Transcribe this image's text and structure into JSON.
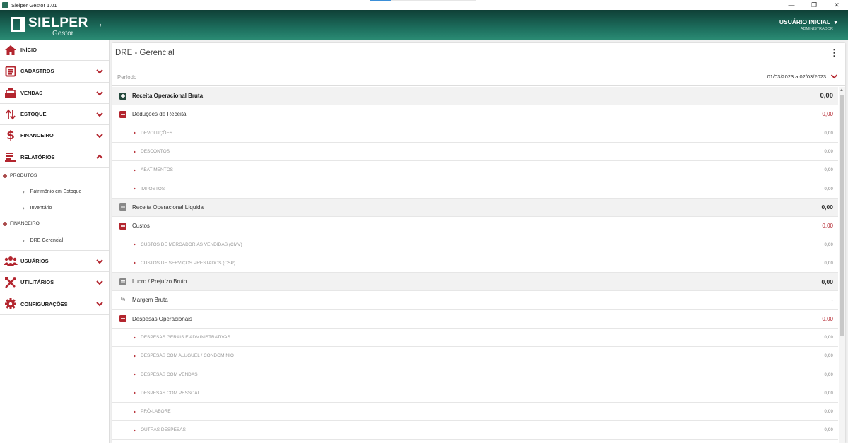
{
  "window": {
    "title": "Sielper Gestor 1.01",
    "controls": [
      "—",
      "❐",
      "✕"
    ]
  },
  "header": {
    "logo_name": "SIELPER",
    "logo_sub": "Gestor",
    "back_icon": "←",
    "user_name": "USUÁRIO INICIAL",
    "user_role": "ADMINISTRADOR",
    "user_caret": "▼"
  },
  "sidebar": {
    "items": [
      {
        "label": "INÍCIO",
        "icon": "home-icon"
      },
      {
        "label": "CADASTROS",
        "icon": "registry-icon"
      },
      {
        "label": "VENDAS",
        "icon": "register-icon"
      },
      {
        "label": "ESTOQUE",
        "icon": "updown-icon"
      },
      {
        "label": "FINANCEIRO",
        "icon": "dollar-icon"
      },
      {
        "label": "RELATÓRIOS",
        "icon": "report-icon"
      },
      {
        "label": "USUÁRIOS",
        "icon": "users-icon"
      },
      {
        "label": "UTILITÁRIOS",
        "icon": "tools-icon"
      },
      {
        "label": "CONFIGURAÇÕES",
        "icon": "gear-icon"
      }
    ],
    "reports": {
      "group1": "PRODUTOS",
      "group1_items": [
        "Patrimônio em Estoque",
        "Inventário"
      ],
      "group2": "FINANCEIRO",
      "group2_items": [
        "DRE Gerencial"
      ]
    }
  },
  "main": {
    "title": "DRE - Gerencial",
    "menu_icon": "⋮",
    "period_label": "Período",
    "period_value": "01/03/2023 a 02/03/2023"
  },
  "rows": [
    {
      "label": "Receita Operacional Bruta",
      "value": "0,00"
    },
    {
      "label": "Deduções de Receita",
      "value": "0,00"
    },
    {
      "label": "DEVOLUÇÕES",
      "value": "0,00"
    },
    {
      "label": "DESCONTOS",
      "value": "0,00"
    },
    {
      "label": "ABATIMENTOS",
      "value": "0,00"
    },
    {
      "label": "IMPOSTOS",
      "value": "0,00"
    },
    {
      "label": "Receita Operacional Líquida",
      "value": "0,00"
    },
    {
      "label": "Custos",
      "value": "0,00"
    },
    {
      "label": "CUSTOS DE MERCADORIAS VENDIDAS (CMV)",
      "value": "0,00"
    },
    {
      "label": "CUSTOS DE SERVIÇOS PRESTADOS (CSP)",
      "value": "0,00"
    },
    {
      "label": "Lucro / Prejuízo Bruto",
      "value": "0,00"
    },
    {
      "label": "Margem Bruta",
      "value": "-",
      "prefix": "%"
    },
    {
      "label": "Despesas Operacionais",
      "value": "0,00"
    },
    {
      "label": "DESPESAS GERAIS E ADMINISTRATIVAS",
      "value": "0,00"
    },
    {
      "label": "DESPESAS COM ALUGUEL / CONDOMÍNIO",
      "value": "0,00"
    },
    {
      "label": "DESPESAS COM VENDAS",
      "value": "0,00"
    },
    {
      "label": "DESPESAS COM PESSOAL",
      "value": "0,00"
    },
    {
      "label": "PRÓ-LABORE",
      "value": "0,00"
    },
    {
      "label": "OUTRAS DESPESAS",
      "value": "0,00"
    }
  ],
  "colors": {
    "header": "#1c6d5c",
    "accent_red": "#b3252e",
    "dark_green": "#24483c"
  }
}
